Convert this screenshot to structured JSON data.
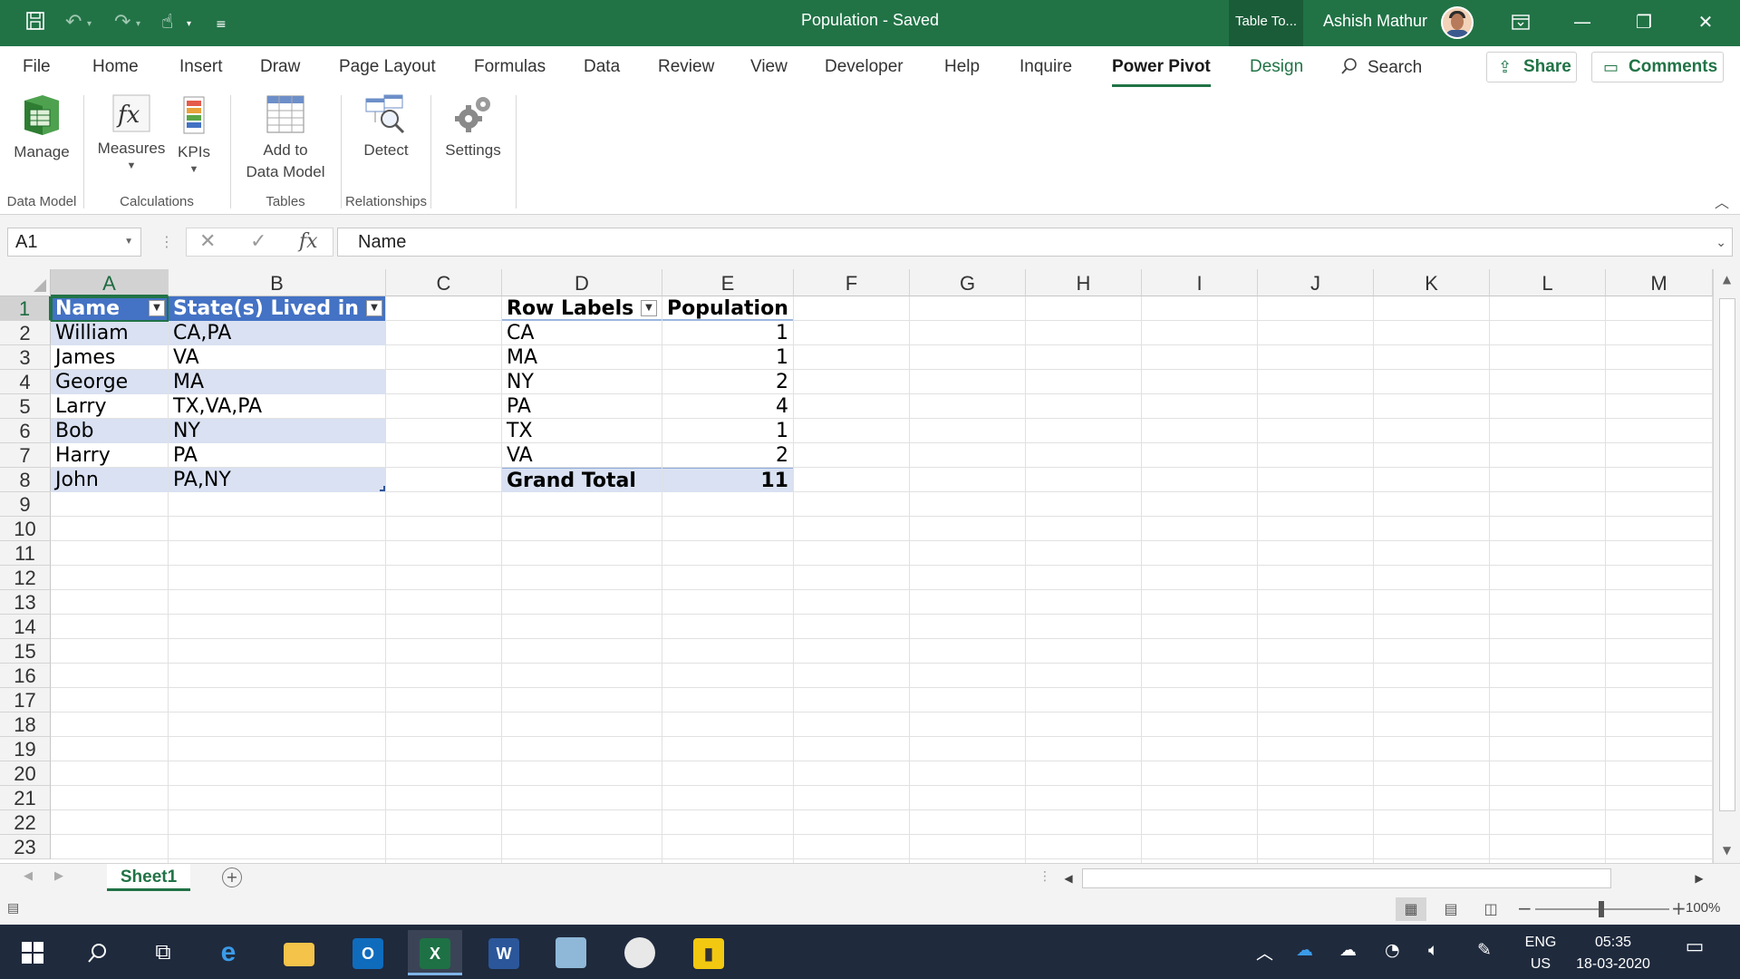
{
  "window": {
    "title": "Population  -  Saved",
    "contextual_tab_group": "Table To...",
    "user_name": "Ashish Mathur",
    "minimize_icon": "minimize-icon",
    "restore_icon": "restore-icon",
    "close_icon": "close-icon",
    "ribbon_display_icon": "ribbon-display-options-icon"
  },
  "quick_access": {
    "icons": [
      "save-icon",
      "undo-icon",
      "redo-icon",
      "touch-mode-icon",
      "customize-icon"
    ]
  },
  "tabs": [
    "File",
    "Home",
    "Insert",
    "Draw",
    "Page Layout",
    "Formulas",
    "Data",
    "Review",
    "View",
    "Developer",
    "Help",
    "Inquire",
    "Power Pivot",
    "Design"
  ],
  "active_tab": "Power Pivot",
  "search_label": "Search",
  "share_label": "Share",
  "comments_label": "Comments",
  "ribbon": {
    "manage": "Manage",
    "measures": "Measures",
    "kpis": "KPIs",
    "add_to_data_model_line1": "Add to",
    "add_to_data_model_line2": "Data Model",
    "detect": "Detect",
    "settings": "Settings",
    "groups": {
      "data_model": "Data Model",
      "calculations": "Calculations",
      "tables": "Tables",
      "relationships": "Relationships"
    }
  },
  "formula_bar": {
    "name_box": "A1",
    "formula": "Name",
    "fx_label": "fx"
  },
  "columns": [
    "A",
    "B",
    "C",
    "D",
    "E",
    "F",
    "G",
    "H",
    "I",
    "J",
    "K",
    "L",
    "M"
  ],
  "rows": [
    "1",
    "2",
    "3",
    "4",
    "5",
    "6",
    "7",
    "8",
    "9",
    "10",
    "11",
    "12",
    "13",
    "14",
    "15",
    "16",
    "17",
    "18",
    "19",
    "20",
    "21",
    "22",
    "23"
  ],
  "table": {
    "headers": [
      "Name",
      "State(s) Lived in"
    ],
    "rows": [
      [
        "William",
        "CA,PA"
      ],
      [
        "James",
        "VA"
      ],
      [
        "George",
        "MA"
      ],
      [
        "Larry",
        "TX,VA,PA"
      ],
      [
        "Bob",
        "NY"
      ],
      [
        "Harry",
        "PA"
      ],
      [
        "John",
        "PA,NY"
      ]
    ]
  },
  "pivot": {
    "header_labels": "Row Labels",
    "header_value": "Population",
    "rows": [
      [
        "CA",
        "1"
      ],
      [
        "MA",
        "1"
      ],
      [
        "NY",
        "2"
      ],
      [
        "PA",
        "4"
      ],
      [
        "TX",
        "1"
      ],
      [
        "VA",
        "2"
      ]
    ],
    "total_label": "Grand Total",
    "total_value": "11"
  },
  "sheet_tab": "Sheet1",
  "status": {
    "zoom": "100%"
  },
  "taskbar": {
    "lang_line1": "ENG",
    "lang_line2": "US",
    "time": "05:35",
    "date": "18-03-2020"
  },
  "colors": {
    "excel_green": "#217346",
    "table_header": "#4472c4",
    "table_band": "#d9e1f2",
    "taskbar": "#1f2a3d"
  }
}
